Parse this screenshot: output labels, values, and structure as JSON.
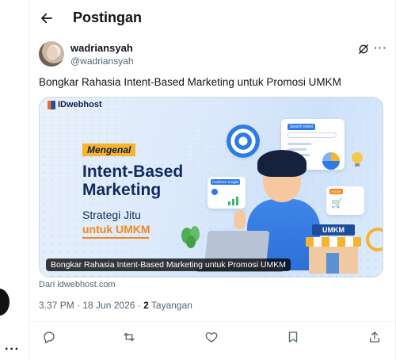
{
  "header": {
    "title": "Postingan"
  },
  "author": {
    "name": "wadriansyah",
    "handle": "@wadriansyah"
  },
  "tweet": {
    "text": "Bongkar Rahasia Intent-Based Marketing untuk Promosi UMKM",
    "timestamp": "3.37 PM · 18 Jun 2026",
    "separator": " · ",
    "views_count": "2",
    "views_label": "Tayangan"
  },
  "card": {
    "brand": "IDwebhost",
    "tag": "Mengenal",
    "headline": "Intent-Based Marketing",
    "subtitle_1": "Strategi Jitu",
    "subtitle_2": "untuk UMKM",
    "store_sign": "UMKM",
    "caption": "Bongkar Rahasia Intent-Based Marketing untuk Promosi UMKM",
    "source": "Dari idwebhost.com",
    "search_card_label": "Search intent",
    "audience_card_label": "Audience Insight",
    "action_card_label": "Action"
  },
  "colors": {
    "accent_blue": "#2d7be5",
    "accent_orange": "#f08a1b",
    "accent_yellow": "#f7b32b",
    "text_primary": "#0f1419",
    "text_secondary": "#536471"
  },
  "icons": {
    "back": "arrow-left-icon",
    "grok": "grok-icon",
    "more": "more-horizontal-icon",
    "reply": "reply-icon",
    "retweet": "retweet-icon",
    "like": "heart-icon",
    "bookmark": "bookmark-icon",
    "share": "share-icon"
  }
}
